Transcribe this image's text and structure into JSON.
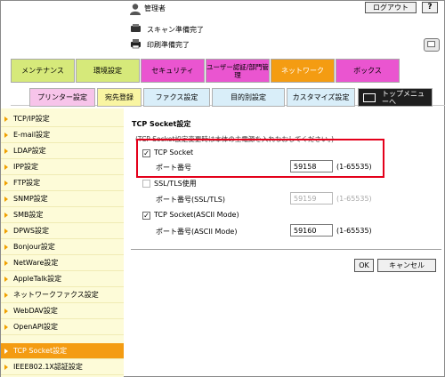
{
  "header": {
    "user_name": "管理者",
    "logout_label": "ログアウト",
    "help_label": "?",
    "scan_status": "スキャン準備完了",
    "print_status": "印刷準備完了",
    "user_icon": "admin-user-icon",
    "scan_icon": "scanner-icon",
    "print_icon": "printer-icon"
  },
  "tabs": [
    {
      "label": "メンテナンス"
    },
    {
      "label": "環境設定"
    },
    {
      "label": "セキュリティ"
    },
    {
      "label": "ユーザー認証/部門管理"
    },
    {
      "label": "ネットワーク",
      "active": true
    },
    {
      "label": "ボックス"
    }
  ],
  "subtabs": [
    {
      "label": "プリンター設定"
    },
    {
      "label": "宛先登録"
    },
    {
      "label": "ファクス設定"
    },
    {
      "label": "目的別設定"
    },
    {
      "label": "カスタマイズ設定"
    },
    {
      "label": "トップメニューへ"
    }
  ],
  "sidebar": {
    "items": [
      {
        "label": "TCP/IP設定"
      },
      {
        "label": "E-mail設定"
      },
      {
        "label": "LDAP設定"
      },
      {
        "label": "IPP設定"
      },
      {
        "label": "FTP設定"
      },
      {
        "label": "SNMP設定"
      },
      {
        "label": "SMB設定"
      },
      {
        "label": "DPWS設定"
      },
      {
        "label": "Bonjour設定"
      },
      {
        "label": "NetWare設定"
      },
      {
        "label": "AppleTalk設定"
      },
      {
        "label": "ネットワークファクス設定"
      },
      {
        "label": "WebDAV設定"
      },
      {
        "label": "OpenAPI設定"
      },
      {
        "label": "TCP Socket設定",
        "active": true
      },
      {
        "label": "IEEE802.1X認証設定"
      }
    ]
  },
  "main": {
    "title": "TCP Socket設定",
    "note": "(TCP Socket設定変更時は本体の主電源を入れなおしてください。)",
    "tcp_socket": {
      "label": "TCP Socket",
      "checked": true,
      "port_label": "ポート番号",
      "port_value": "59158",
      "range": "(1-65535)"
    },
    "ssl_tls": {
      "label": "SSL/TLS使用",
      "checked": false,
      "port_label": "ポート番号(SSL/TLS)",
      "port_value": "59159",
      "range": "(1-65535)"
    },
    "ascii": {
      "label": "TCP Socket(ASCII Mode)",
      "checked": true,
      "port_label": "ポート番号(ASCII Mode)",
      "port_value": "59160",
      "range": "(1-65535)"
    },
    "ok_label": "OK",
    "cancel_label": "キャンセル"
  },
  "colors": {
    "tab_green": "#d6e97a",
    "tab_magenta": "#ea55d0",
    "tab_active": "#f49c12",
    "sidebar_bg": "#fdfbd8",
    "highlight": "#e4001b"
  }
}
